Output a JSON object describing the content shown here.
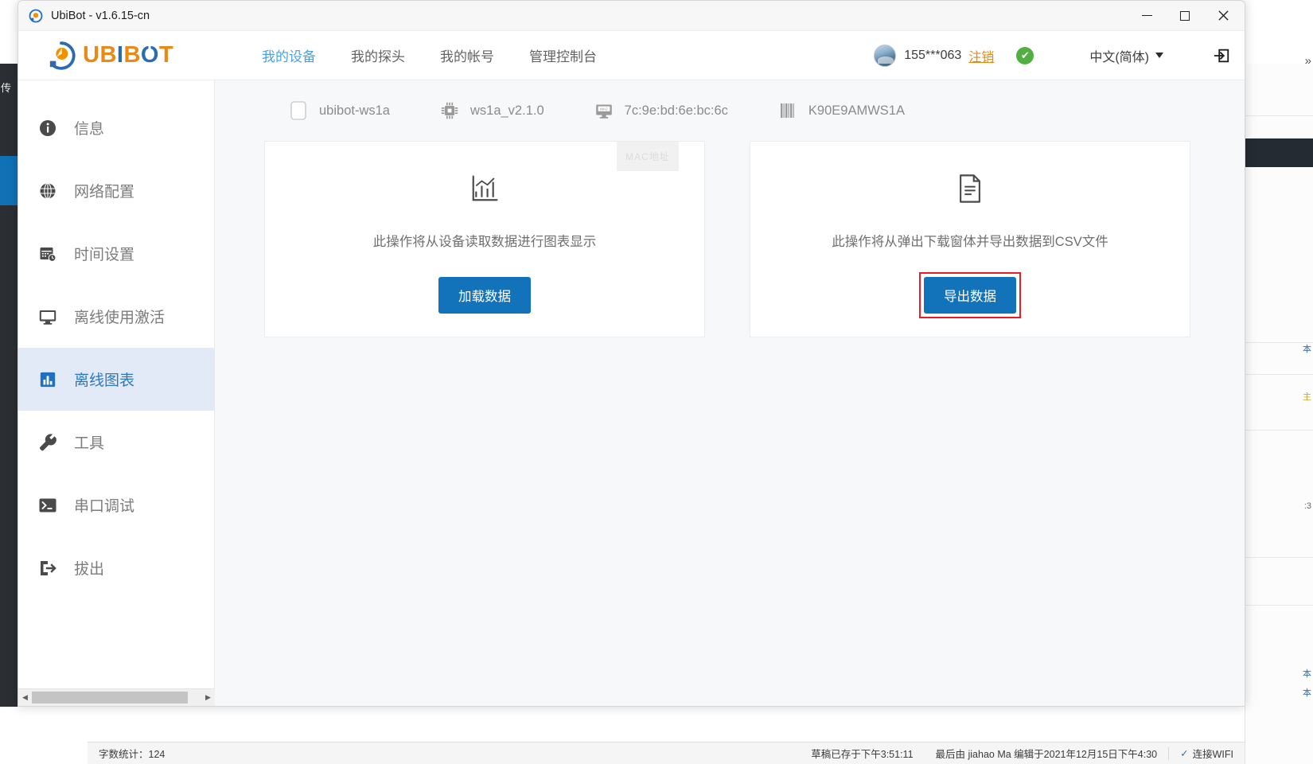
{
  "colors": {
    "brand_orange": "#e98a17",
    "brand_blue": "#2b6cb0",
    "accent_button": "#1272ba",
    "active_nav": "#4f9fe0",
    "sidebar_active_bg": "#e3eaf7",
    "highlight_red": "#ec1c24",
    "status_green": "#52b043",
    "logout_orange": "#e08b16"
  },
  "titlebar": {
    "app_icon": "ubibot-app-icon",
    "title": "UbiBot - v1.6.15-cn",
    "minimize_label": "—",
    "maximize_label": "□",
    "close_label": "✕"
  },
  "header": {
    "logo": {
      "mark": "ubibot-logo-mark",
      "part1": "UB",
      "part2": "I",
      "part3": "B",
      "part4": "O",
      "part5": "T"
    },
    "nav": [
      {
        "label": "我的设备",
        "active": true,
        "name": "nav-my-devices"
      },
      {
        "label": "我的探头",
        "active": false,
        "name": "nav-my-probes"
      },
      {
        "label": "我的帐号",
        "active": false,
        "name": "nav-my-account"
      },
      {
        "label": "管理控制台",
        "active": false,
        "name": "nav-admin-console"
      }
    ],
    "user": {
      "avatar": "user-avatar",
      "username": "155***063",
      "logout_label": "注销",
      "status_icon": "green-check-icon",
      "status_glyph": "✔"
    },
    "language": {
      "selected": "中文(简体)",
      "caret": "chevron-down-icon"
    },
    "exit_icon": "exit-login-icon",
    "edge_chevron": "»"
  },
  "sidebar": {
    "items": [
      {
        "label": "信息",
        "icon": "info-circle-icon",
        "active": false,
        "name": "sidebar-item-info"
      },
      {
        "label": "网络配置",
        "icon": "globe-icon",
        "active": false,
        "name": "sidebar-item-network"
      },
      {
        "label": "时间设置",
        "icon": "calendar-clock-icon",
        "active": false,
        "name": "sidebar-item-time"
      },
      {
        "label": "离线使用激活",
        "icon": "monitor-icon",
        "active": false,
        "name": "sidebar-item-offline-activate"
      },
      {
        "label": "离线图表",
        "icon": "bar-chart-icon",
        "active": true,
        "name": "sidebar-item-offline-chart"
      },
      {
        "label": "工具",
        "icon": "wrench-icon",
        "active": false,
        "name": "sidebar-item-tools"
      },
      {
        "label": "串口调试",
        "icon": "terminal-icon",
        "active": false,
        "name": "sidebar-item-serial-debug"
      },
      {
        "label": "拔出",
        "icon": "eject-icon",
        "active": false,
        "name": "sidebar-item-eject"
      }
    ]
  },
  "device_bar": [
    {
      "icon": "device-icon",
      "text": "ubibot-ws1a",
      "name": "device-name"
    },
    {
      "icon": "chip-icon",
      "text": "ws1a_v2.1.0",
      "name": "device-firmware"
    },
    {
      "icon": "mac-icon",
      "text": "7c:9e:bd:6e:bc:6c",
      "name": "device-mac"
    },
    {
      "icon": "barcode-icon",
      "text": "K90E9AMWS1A",
      "name": "device-serial"
    }
  ],
  "cards": [
    {
      "icon": "chart-bars-icon",
      "description": "此操作将从设备读取数据进行图表显示",
      "button_label": "加载数据",
      "highlighted": false,
      "ghost_tooltip": "MAC地址"
    },
    {
      "icon": "document-lines-icon",
      "description": "此操作将从弹出下载窗体并导出数据到CSV文件",
      "button_label": "导出数据",
      "highlighted": true,
      "ghost_tooltip": ""
    }
  ],
  "hscroll": {
    "left_arrow": "◀",
    "right_arrow": "▶"
  },
  "status_bar": {
    "word_count": "字数统计：124",
    "saved_info": "草稿已存于下午3:51:11",
    "last_edit": "最后由 jiahao Ma 编辑于2021年12月15日下午4:30",
    "wifi_label": "连接WIFI",
    "wifi_icon": "wifi-check-icon"
  },
  "background": {
    "left_char": "传",
    "right_texts": [
      "本",
      "本",
      "本"
    ],
    "right_yellow": "主",
    "right_small": ":3"
  }
}
